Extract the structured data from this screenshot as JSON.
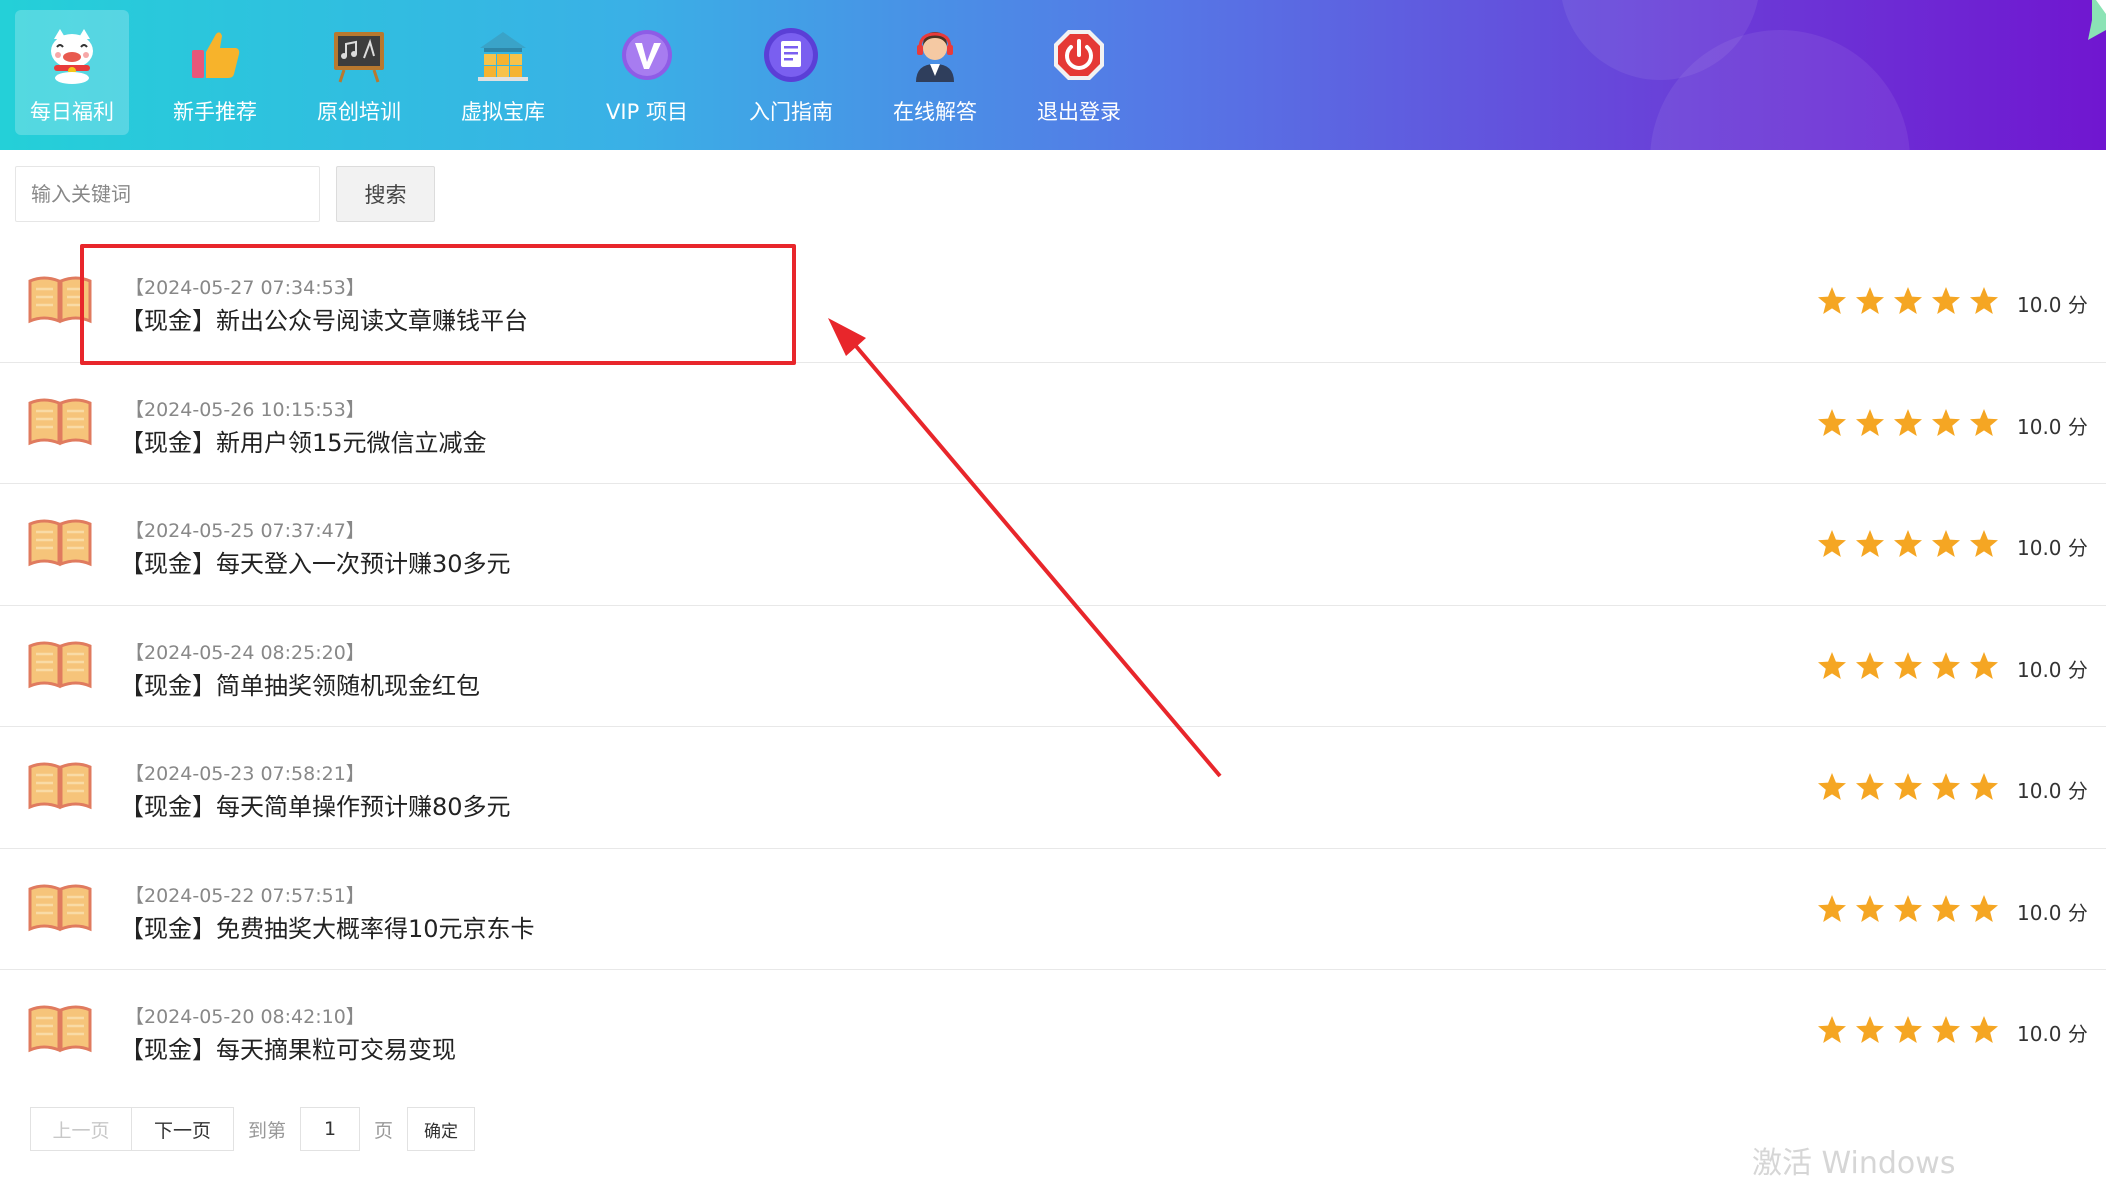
{
  "nav": {
    "items": [
      {
        "label": "每日福利",
        "icon": "lucky-cat-icon",
        "active": true
      },
      {
        "label": "新手推荐",
        "icon": "thumbs-up-icon",
        "active": false
      },
      {
        "label": "原创培训",
        "icon": "blackboard-icon",
        "active": false
      },
      {
        "label": "虚拟宝库",
        "icon": "treasure-boxes-icon",
        "active": false
      },
      {
        "label": "VIP 项目",
        "icon": "vip-badge-icon",
        "active": false
      },
      {
        "label": "入门指南",
        "icon": "guide-document-icon",
        "active": false
      },
      {
        "label": "在线解答",
        "icon": "support-agent-icon",
        "active": false
      },
      {
        "label": "退出登录",
        "icon": "power-off-icon",
        "active": false
      }
    ]
  },
  "search": {
    "placeholder": "输入关键词",
    "value": "",
    "button_label": "搜索"
  },
  "list": {
    "items": [
      {
        "date": "【2024-05-27 07:34:53】",
        "title": "【现金】新出公众号阅读文章赚钱平台",
        "stars": 5,
        "score": "10.0 分"
      },
      {
        "date": "【2024-05-26 10:15:53】",
        "title": "【现金】新用户领15元微信立减金",
        "stars": 5,
        "score": "10.0 分"
      },
      {
        "date": "【2024-05-25 07:37:47】",
        "title": "【现金】每天登入一次预计赚30多元",
        "stars": 5,
        "score": "10.0 分"
      },
      {
        "date": "【2024-05-24 08:25:20】",
        "title": "【现金】简单抽奖领随机现金红包",
        "stars": 5,
        "score": "10.0 分"
      },
      {
        "date": "【2024-05-23 07:58:21】",
        "title": "【现金】每天简单操作预计赚80多元",
        "stars": 5,
        "score": "10.0 分"
      },
      {
        "date": "【2024-05-22 07:57:51】",
        "title": "【现金】免费抽奖大概率得10元京东卡",
        "stars": 5,
        "score": "10.0 分"
      },
      {
        "date": "【2024-05-20 08:42:10】",
        "title": "【现金】每天摘果粒可交易变现",
        "stars": 5,
        "score": "10.0 分"
      }
    ]
  },
  "pagination": {
    "prev_label": "上一页",
    "next_label": "下一页",
    "goto_label": "到第",
    "page_value": "1",
    "page_unit": "页",
    "confirm_label": "确定"
  },
  "watermark": "激活 Windows",
  "colors": {
    "annotation": "#e8262b",
    "star": "#f5a623",
    "nav_gradient_start": "#24d0d8",
    "nav_gradient_end": "#7016d0"
  }
}
